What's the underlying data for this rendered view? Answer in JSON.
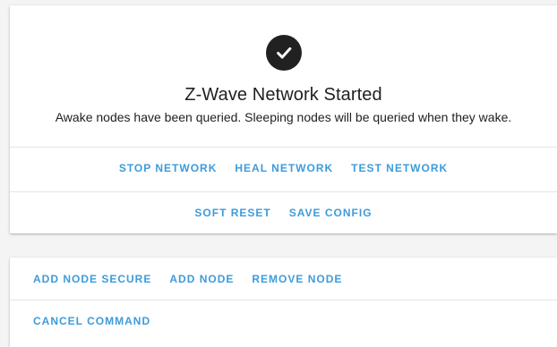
{
  "theme": {
    "accent": "#3d9bdb",
    "text": "#212121",
    "card_bg": "#ffffff",
    "page_bg": "#f4f4f4",
    "divider": "#e4e4e4"
  },
  "network_card": {
    "status_icon": "check-circle-icon",
    "status_title": "Z-Wave Network Started",
    "status_message": "Awake nodes have been queried. Sleeping nodes will be queried when they wake.",
    "network_actions": [
      {
        "label": "STOP NETWORK"
      },
      {
        "label": "HEAL NETWORK"
      },
      {
        "label": "TEST NETWORK"
      }
    ],
    "config_actions": [
      {
        "label": "SOFT RESET"
      },
      {
        "label": "SAVE CONFIG"
      }
    ]
  },
  "nodes_card": {
    "node_actions": [
      {
        "label": "ADD NODE SECURE"
      },
      {
        "label": "ADD NODE"
      },
      {
        "label": "REMOVE NODE"
      }
    ],
    "cancel_action": {
      "label": "CANCEL COMMAND"
    }
  }
}
